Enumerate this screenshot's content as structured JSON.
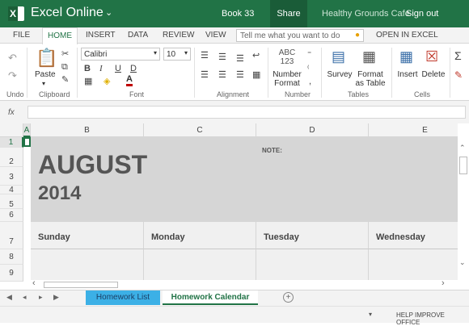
{
  "header": {
    "app_name": "Excel Online",
    "book_name": "Book 33",
    "share_label": "Share",
    "site_name": "Healthy Grounds Cafe",
    "signout_label": "Sign out"
  },
  "tabs": [
    "FILE",
    "HOME",
    "INSERT",
    "DATA",
    "REVIEW",
    "VIEW"
  ],
  "tell_me_placeholder": "Tell me what you want to do",
  "open_in_excel": "OPEN IN EXCEL",
  "ribbon": {
    "undo_label": "Undo",
    "clipboard_label": "Clipboard",
    "paste_label": "Paste",
    "font_label": "Font",
    "font_name": "Calibri",
    "font_size": "10",
    "bold": "B",
    "italic": "I",
    "underline": "U",
    "double_underline": "D",
    "alignment_label": "Alignment",
    "number_label": "Number",
    "number_format_label": "Number Format",
    "number_format_icon_text": "ABC 123",
    "tables_label": "Tables",
    "survey_label": "Survey",
    "format_as_table_label": "Format as Table",
    "cells_label": "Cells",
    "insert_label": "Insert",
    "delete_label": "Delete"
  },
  "formula_bar": {
    "fx": "fx",
    "value": ""
  },
  "grid": {
    "columns": [
      "A",
      "B",
      "C",
      "D",
      "E"
    ],
    "rows": [
      "1",
      "2",
      "3",
      "4",
      "5",
      "6",
      "7",
      "8",
      "9"
    ],
    "month": "AUGUST",
    "year": "2014",
    "note": "NOTE:",
    "day_headers": [
      "Sunday",
      "Monday",
      "Tuesday",
      "Wednesday"
    ]
  },
  "sheets": [
    {
      "name": "Homework List",
      "active": false
    },
    {
      "name": "Homework Calendar",
      "active": true
    }
  ],
  "status": {
    "help_label": "HELP IMPROVE OFFICE"
  },
  "colors": {
    "excel_green": "#217346",
    "sheet_tab_blue": "#3cb0e6",
    "band_gray": "#d6d6d6"
  }
}
